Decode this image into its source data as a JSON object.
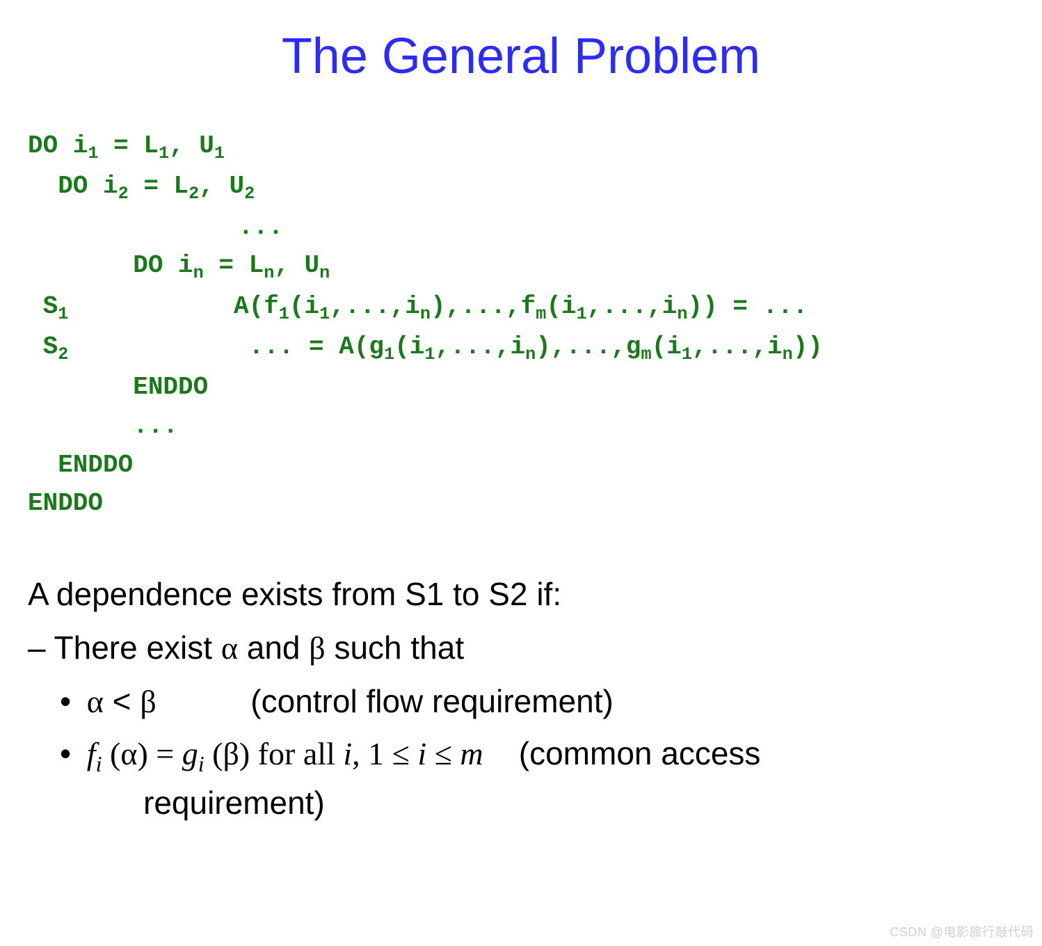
{
  "title": "The General Problem",
  "code": {
    "l1a": "DO i",
    "l1s": "1",
    "l1b": " = L",
    "l1s2": "1",
    "l1c": ", U",
    "l1s3": "1",
    "l2a": "  DO i",
    "l2s": "2",
    "l2b": " = L",
    "l2s2": "2",
    "l2c": ", U",
    "l2s3": "2",
    "l3": "              ...",
    "l4a": "       DO i",
    "l4s": "n",
    "l4b": " = L",
    "l4s2": "n",
    "l4c": ", U",
    "l4s3": "n",
    "l5_label": " S",
    "l5_ls": "1",
    "l5_pad": "           ",
    "l5a": "A(f",
    "l5s1": "1",
    "l5b": "(i",
    "l5s2": "1",
    "l5c": ",...,i",
    "l5s3": "n",
    "l5d": "),...,f",
    "l5s4": "m",
    "l5e": "(i",
    "l5s5": "1",
    "l5f": ",...,i",
    "l5s6": "n",
    "l5g": ")) = ...",
    "l6_label": " S",
    "l6_ls": "2",
    "l6_pad": "            ",
    "l6a": "... = A(g",
    "l6s1": "1",
    "l6b": "(i",
    "l6s2": "1",
    "l6c": ",...,i",
    "l6s3": "n",
    "l6d": "),...,g",
    "l6s4": "m",
    "l6e": "(i",
    "l6s5": "1",
    "l6f": ",...,i",
    "l6s6": "n",
    "l6g": "))",
    "l7": "       ENDDO",
    "l8": "       ...",
    "l9": "  ENDDO",
    "l10": "ENDDO"
  },
  "text": {
    "lead": "A dependence exists from S1 to S2 if:",
    "sub1_prefix": "– There exist ",
    "alpha": "α",
    "and": " and ",
    "beta": "β",
    "sub1_suffix": " such that",
    "bullet": "•",
    "lt": " < ",
    "cf_note": "(control flow requirement)",
    "fi": "f",
    "fi_sub": "i",
    "eq": " (",
    "eq2": ") = ",
    "gi": "g",
    "gi_sub": "i",
    "close_paren": ")",
    "for_all": " for all ",
    "i_var": "i",
    "range": ", 1 ≤ ",
    "range2": " ≤ ",
    "m_var": "m",
    "ca_note1": "(common access",
    "ca_note2": "requirement)"
  },
  "watermark": "CSDN @电影旅行敲代码"
}
